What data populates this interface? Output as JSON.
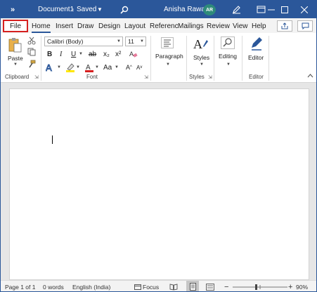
{
  "titlebar": {
    "more": "»",
    "doc_name": "Document1",
    "separator": "-",
    "saved": "Saved",
    "user_name": "Anisha Rawat",
    "avatar_initials": "AR"
  },
  "tabs": [
    "File",
    "Home",
    "Insert",
    "Draw",
    "Design",
    "Layout",
    "Referenc",
    "Mailings",
    "Review",
    "View",
    "Help"
  ],
  "ribbon": {
    "paste": "Paste",
    "font_name": "Calibri (Body)",
    "font_size": "11",
    "bold": "B",
    "italic": "I",
    "underline": "U",
    "strike": "ab",
    "subscript": "x₂",
    "superscript": "x²",
    "change_case": "Aa",
    "paragraph": "Paragraph",
    "styles": "Styles",
    "editing": "Editing",
    "editor": "Editor",
    "groups": {
      "clipboard": "Clipboard",
      "font": "Font",
      "styles": "Styles",
      "editor": "Editor"
    }
  },
  "statusbar": {
    "page": "Page 1 of 1",
    "words": "0 words",
    "language": "English (India)",
    "focus": "Focus",
    "zoom": "90%"
  },
  "colors": {
    "accent": "#2b579a",
    "highlight": "#d62020"
  }
}
